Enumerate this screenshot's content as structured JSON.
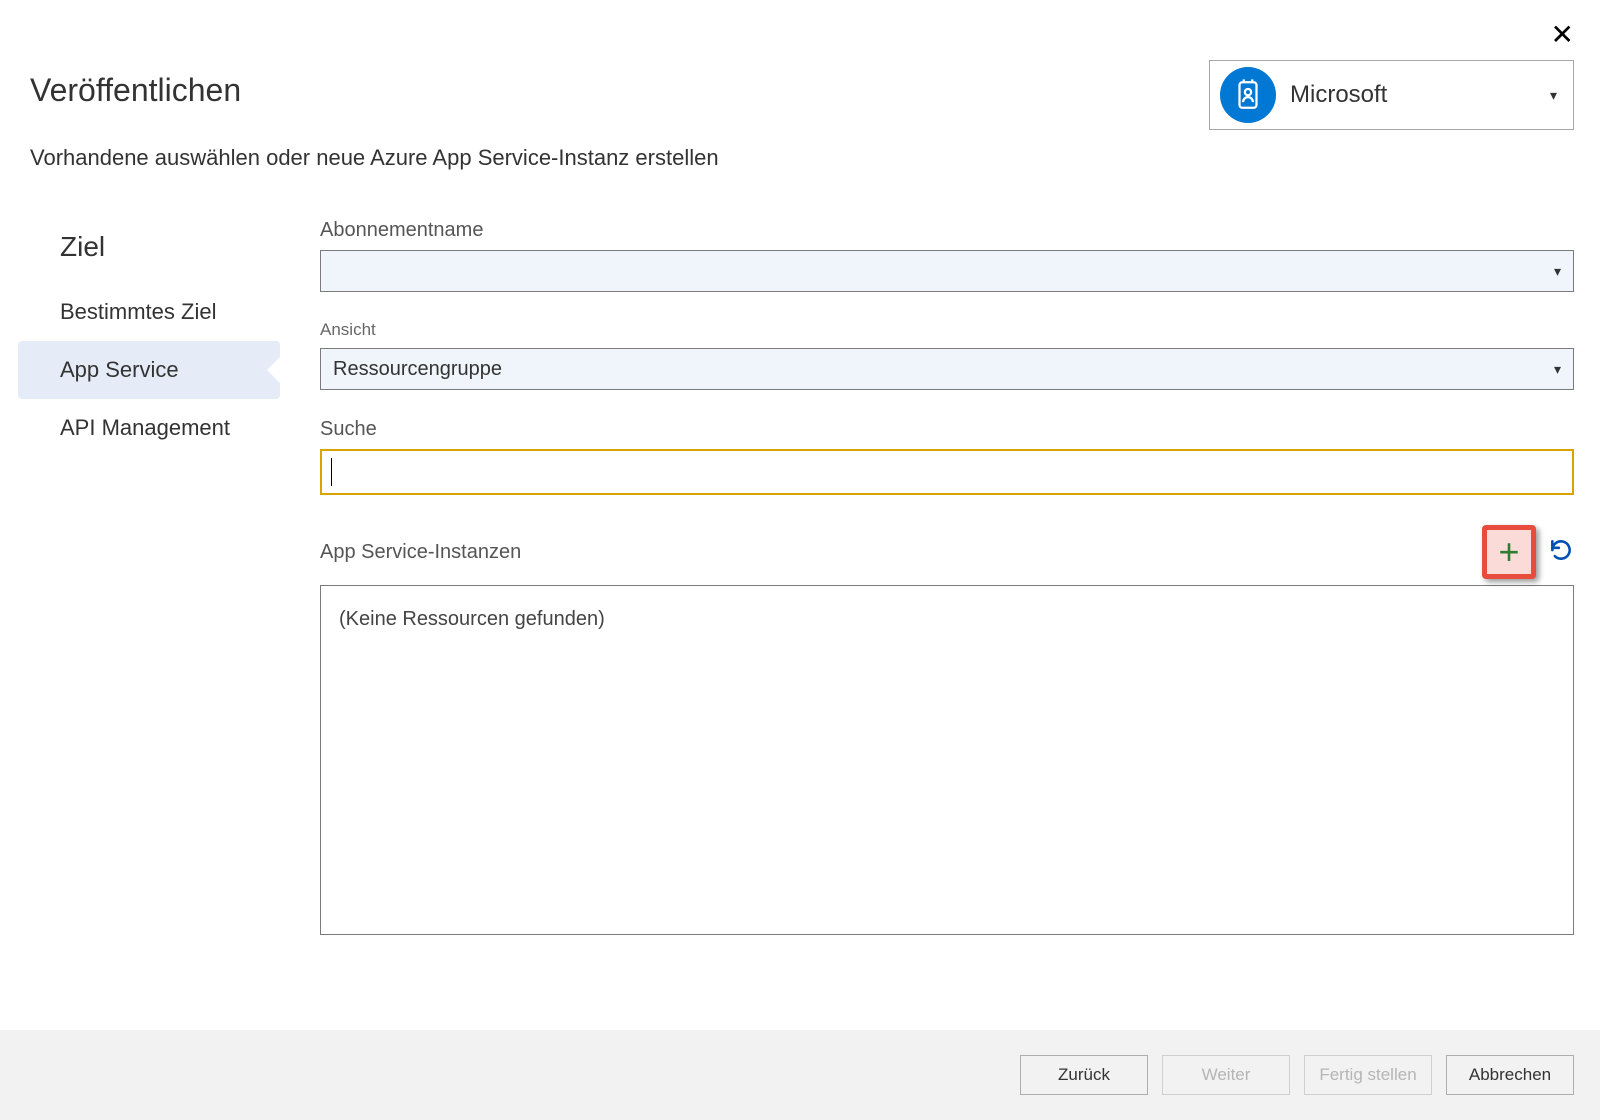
{
  "header": {
    "title": "Veröffentlichen",
    "subtitle": "Vorhandene auswählen oder neue Azure App Service-Instanz erstellen"
  },
  "account": {
    "name": "Microsoft"
  },
  "sidebar": {
    "heading": "Ziel",
    "items": [
      {
        "label": "Bestimmtes Ziel",
        "selected": false
      },
      {
        "label": "App Service",
        "selected": true
      },
      {
        "label": "API Management",
        "selected": false
      }
    ]
  },
  "form": {
    "subscription_label": "Abonnementname",
    "subscription_value": "",
    "view_label": "Ansicht",
    "view_value": "Ressourcengruppe",
    "search_label": "Suche",
    "search_value": "",
    "instances_label": "App Service-Instanzen",
    "instances_empty_text": "(Keine Ressourcen gefunden)"
  },
  "footer": {
    "back": "Zurück",
    "next": "Weiter",
    "finish": "Fertig stellen",
    "cancel": "Abbrechen"
  }
}
